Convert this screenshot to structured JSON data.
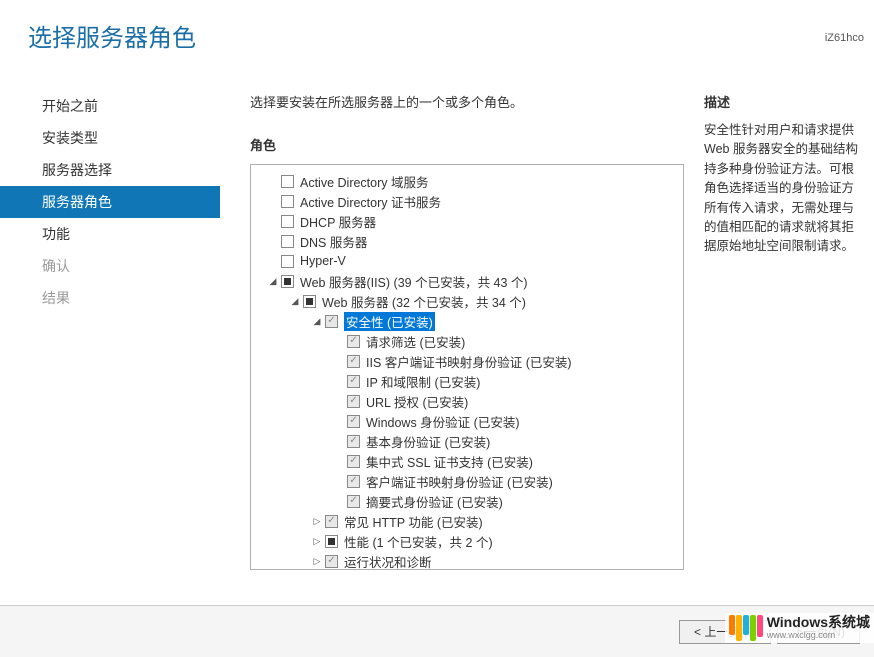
{
  "header": {
    "title": "选择服务器角色",
    "hostname": "iZ61hco"
  },
  "sidebar": {
    "items": [
      {
        "label": "开始之前",
        "state": "normal"
      },
      {
        "label": "安装类型",
        "state": "normal"
      },
      {
        "label": "服务器选择",
        "state": "normal"
      },
      {
        "label": "服务器角色",
        "state": "active"
      },
      {
        "label": "功能",
        "state": "normal"
      },
      {
        "label": "确认",
        "state": "disabled"
      },
      {
        "label": "结果",
        "state": "disabled"
      }
    ]
  },
  "main": {
    "instruction": "选择要安装在所选服务器上的一个或多个角色。",
    "roles_label": "角色",
    "desc_label": "描述",
    "description": "安全性针对用户和请求提供 Web 服务器安全的基础结构持多种身份验证方法。可根角色选择适当的身份验证方所有传入请求，无需处理与的值相匹配的请求就将其拒据原始地址空间限制请求。"
  },
  "tree": [
    {
      "indent": 0,
      "expander": "none",
      "check": "empty",
      "label": "Active Directory 域服务"
    },
    {
      "indent": 0,
      "expander": "none",
      "check": "empty",
      "label": "Active Directory 证书服务"
    },
    {
      "indent": 0,
      "expander": "none",
      "check": "empty",
      "label": "DHCP 服务器"
    },
    {
      "indent": 0,
      "expander": "none",
      "check": "empty",
      "label": "DNS 服务器"
    },
    {
      "indent": 0,
      "expander": "none",
      "check": "empty",
      "label": "Hyper-V"
    },
    {
      "indent": 0,
      "expander": "open",
      "check": "partial",
      "label": "Web 服务器(IIS) (39 个已安装，共 43 个)"
    },
    {
      "indent": 1,
      "expander": "open",
      "check": "partial",
      "label": "Web 服务器 (32 个已安装，共 34 个)"
    },
    {
      "indent": 2,
      "expander": "open",
      "check": "checked-gray",
      "label": "安全性 (已安装)",
      "selected": true
    },
    {
      "indent": 3,
      "expander": "none",
      "check": "checked-gray",
      "label": "请求筛选 (已安装)"
    },
    {
      "indent": 3,
      "expander": "none",
      "check": "checked-gray",
      "label": "IIS 客户端证书映射身份验证 (已安装)"
    },
    {
      "indent": 3,
      "expander": "none",
      "check": "checked-gray",
      "label": "IP 和域限制 (已安装)"
    },
    {
      "indent": 3,
      "expander": "none",
      "check": "checked-gray",
      "label": "URL 授权 (已安装)"
    },
    {
      "indent": 3,
      "expander": "none",
      "check": "checked-gray",
      "label": "Windows 身份验证 (已安装)"
    },
    {
      "indent": 3,
      "expander": "none",
      "check": "checked-gray",
      "label": "基本身份验证 (已安装)"
    },
    {
      "indent": 3,
      "expander": "none",
      "check": "checked-gray",
      "label": "集中式 SSL 证书支持 (已安装)"
    },
    {
      "indent": 3,
      "expander": "none",
      "check": "checked-gray",
      "label": "客户端证书映射身份验证 (已安装)"
    },
    {
      "indent": 3,
      "expander": "none",
      "check": "checked-gray",
      "label": "摘要式身份验证 (已安装)"
    },
    {
      "indent": 2,
      "expander": "closed",
      "check": "checked-gray",
      "label": "常见 HTTP 功能 (已安装)"
    },
    {
      "indent": 2,
      "expander": "closed",
      "check": "partial",
      "label": "性能 (1 个已安装，共 2 个)"
    },
    {
      "indent": 2,
      "expander": "closed",
      "check": "checked-gray",
      "label": "运行状况和诊断"
    }
  ],
  "footer": {
    "prev": "< 上一步(P)",
    "next": "下一页(N)"
  },
  "watermark": {
    "main": "Windows系统城",
    "sub": "www.wxclgg.com"
  }
}
